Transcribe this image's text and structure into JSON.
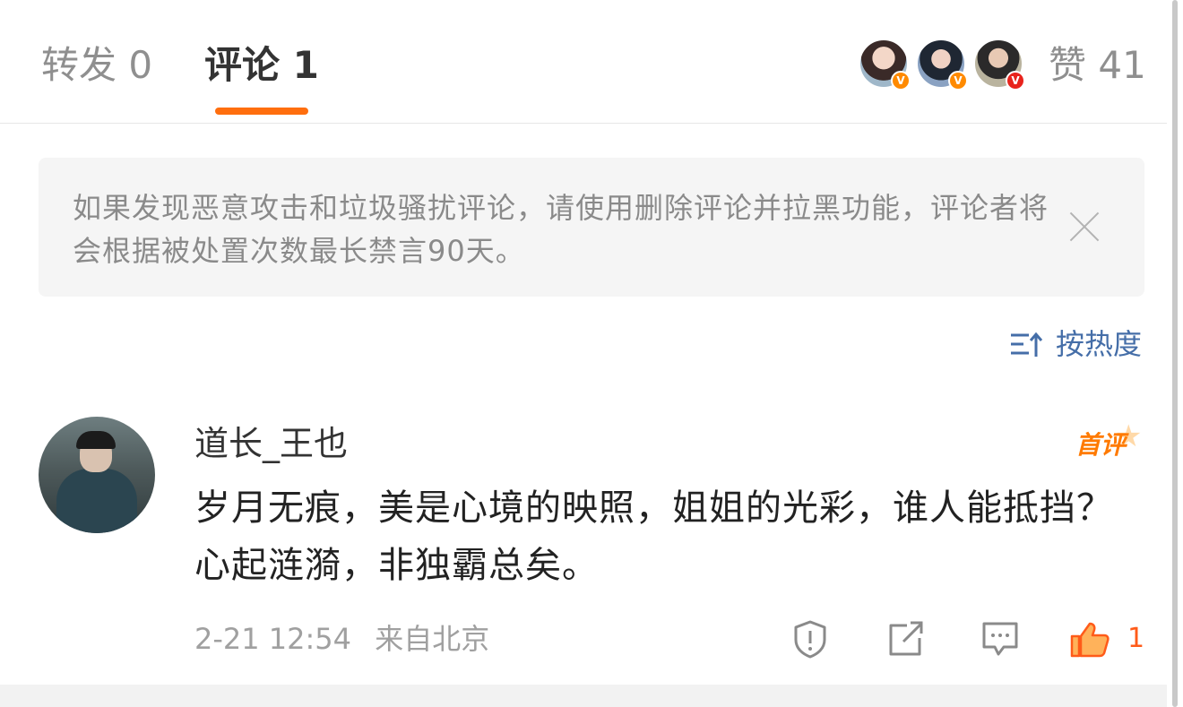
{
  "tabs": {
    "repost_label": "转发 0",
    "comment_label": "评论 1",
    "like_label": "赞 41"
  },
  "likers": [
    {
      "badge": "V"
    },
    {
      "badge": "V"
    },
    {
      "badge": "V"
    }
  ],
  "notice": {
    "text": "如果发现恶意攻击和垃圾骚扰评论，请使用删除评论并拉黑功能，评论者将会根据被处置次数最长禁言90天。"
  },
  "sort": {
    "label": "按热度"
  },
  "comment": {
    "author": "道长_王也",
    "badge": "首评",
    "text": "岁月无痕，美是心境的映照，姐姐的光彩，谁人能抵挡？心起涟漪，非独霸总矣。",
    "time": "2-21 12:54",
    "source": "来自北京",
    "like_count": "1"
  },
  "colors": {
    "accent": "#ff6e0e",
    "link": "#456ea8",
    "like": "#ff5b19"
  },
  "icons": {
    "report": "report-icon",
    "share": "share-icon",
    "reply": "reply-icon",
    "like": "thumbs-up-icon",
    "sort": "sort-icon",
    "close": "close-icon"
  }
}
